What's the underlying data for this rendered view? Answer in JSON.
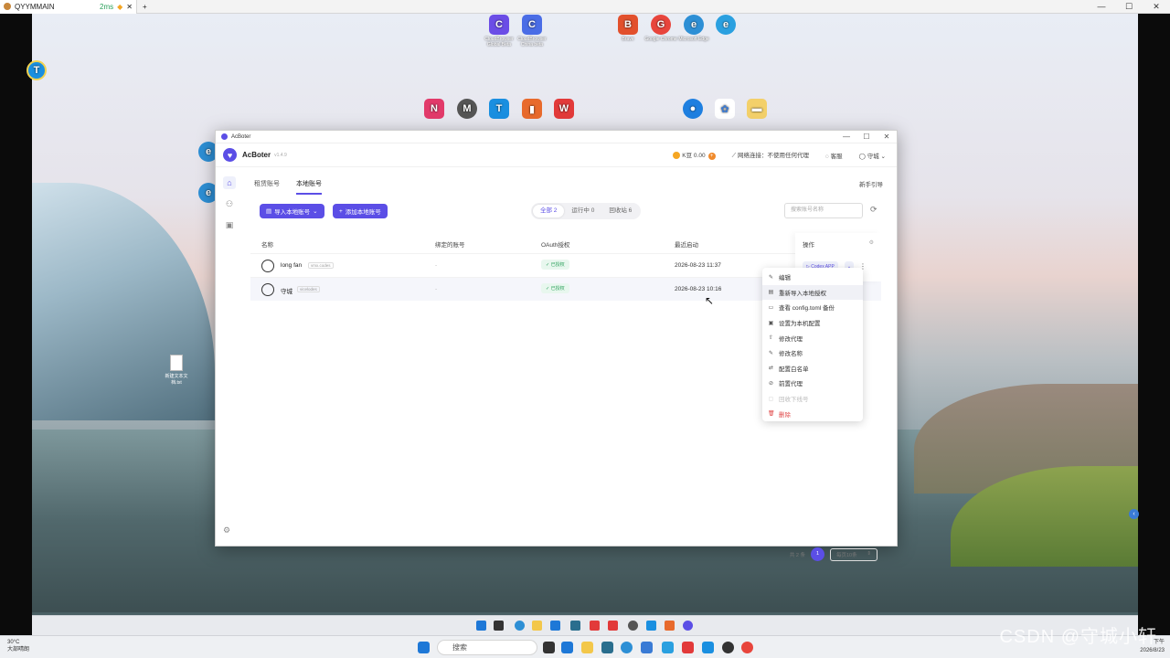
{
  "remote_bar": {
    "tab_title": "QYYMMAIN",
    "latency": "2ms"
  },
  "desktop_icons": [
    {
      "label": "CloudBrowser Global Beta",
      "color": "#6b4de6",
      "glyph": "C"
    },
    {
      "label": "CloudBrowser China beta",
      "color": "#4a6de6",
      "glyph": "C"
    },
    {
      "label": "Brave",
      "color": "#e2502c",
      "glyph": "B"
    },
    {
      "label": "Google Chrome",
      "color": "#e8453c",
      "glyph": "G"
    },
    {
      "label": "Microsoft Edge",
      "color": "#2d8fd5",
      "glyph": "e"
    },
    {
      "label": "ToDesk",
      "color": "#1a8fe0",
      "glyph": "T"
    },
    {
      "label": "Moonlight",
      "color": "#555555",
      "glyph": "M"
    },
    {
      "label": "WPS Office",
      "color": "#e23a3a",
      "glyph": "W"
    }
  ],
  "desktop_file": {
    "label": "新建文本文档.txt"
  },
  "app": {
    "window_title": "AcBoter",
    "name": "AcBoter",
    "version": "v1.4.9",
    "coins": "K豆 0.00",
    "network": "网络连接：不使用任何代理",
    "service": "客服",
    "user": "守城",
    "tabs": [
      "租赁账号",
      "本地账号"
    ],
    "guide": "新手引导",
    "import_button": "导入本地账号",
    "add_button": "添加本地账号",
    "filters": [
      "全部 2",
      "运行中 0",
      "回收站 6"
    ],
    "search_placeholder": "搜索账号名称",
    "columns": {
      "name": "名称",
      "bound": "绑定的账号",
      "oauth": "OAuth授权",
      "last_start": "最近启动",
      "ops": "操作"
    },
    "rows": [
      {
        "name": "long fan",
        "tag": "vmx.codes",
        "bound": "-",
        "oauth": "已授权",
        "time": "2026-08-23 11:37"
      },
      {
        "name": "守城",
        "tag": "vicelodes",
        "bound": "-",
        "oauth": "已授权",
        "time": "2026-08-23 10:16"
      }
    ],
    "codex_button": "Codex APP",
    "menu": [
      {
        "label": "编辑",
        "icon": "✎",
        "state": "normal"
      },
      {
        "label": "重新导入本地授权",
        "icon": "▤",
        "state": "hover"
      },
      {
        "label": "查看 config.toml 备份",
        "icon": "▭",
        "state": "normal"
      },
      {
        "label": "设置为本机配置",
        "icon": "▣",
        "state": "normal"
      },
      {
        "label": "修改代理",
        "icon": "⇧",
        "state": "normal"
      },
      {
        "label": "修改名称",
        "icon": "✎",
        "state": "normal"
      },
      {
        "label": "配置白名单",
        "icon": "⇄",
        "state": "normal"
      },
      {
        "label": "前置代理",
        "icon": "⊘",
        "state": "normal"
      },
      {
        "label": "回收下线号",
        "icon": "▢",
        "state": "disabled"
      },
      {
        "label": "删除",
        "icon": "🗑",
        "state": "danger"
      }
    ],
    "pager": {
      "total": "共 2 条",
      "page": "1",
      "size": "每页10条"
    }
  },
  "inner_taskbar": {},
  "outer_taskbar": {
    "weather_temp": "30°C",
    "weather_desc": "大部晴朗",
    "search": "搜索",
    "time": "下午",
    "date": "2026/8/23"
  },
  "watermark": "CSDN @守城小轩"
}
